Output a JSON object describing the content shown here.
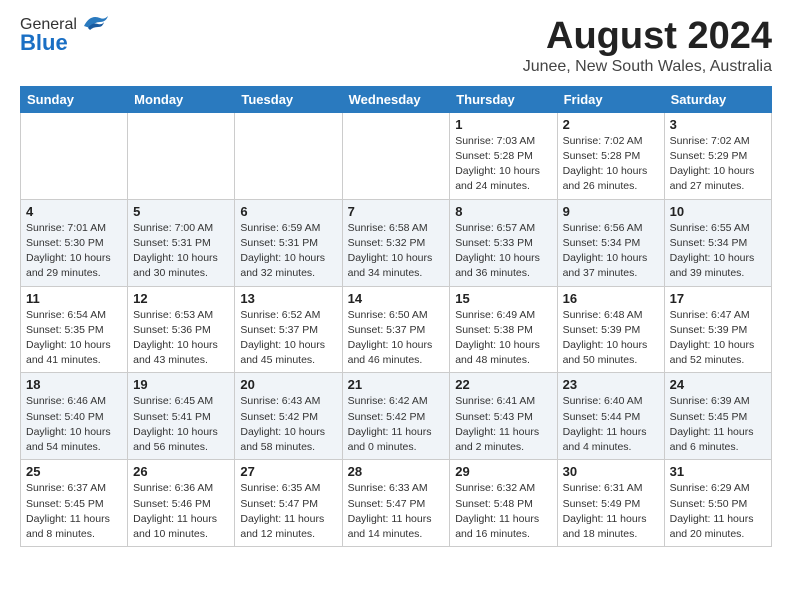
{
  "logo": {
    "general": "General",
    "blue": "Blue"
  },
  "title": "August 2024",
  "subtitle": "Junee, New South Wales, Australia",
  "weekdays": [
    "Sunday",
    "Monday",
    "Tuesday",
    "Wednesday",
    "Thursday",
    "Friday",
    "Saturday"
  ],
  "weeks": [
    [
      {
        "day": "",
        "info": ""
      },
      {
        "day": "",
        "info": ""
      },
      {
        "day": "",
        "info": ""
      },
      {
        "day": "",
        "info": ""
      },
      {
        "day": "1",
        "info": "Sunrise: 7:03 AM\nSunset: 5:28 PM\nDaylight: 10 hours\nand 24 minutes."
      },
      {
        "day": "2",
        "info": "Sunrise: 7:02 AM\nSunset: 5:28 PM\nDaylight: 10 hours\nand 26 minutes."
      },
      {
        "day": "3",
        "info": "Sunrise: 7:02 AM\nSunset: 5:29 PM\nDaylight: 10 hours\nand 27 minutes."
      }
    ],
    [
      {
        "day": "4",
        "info": "Sunrise: 7:01 AM\nSunset: 5:30 PM\nDaylight: 10 hours\nand 29 minutes."
      },
      {
        "day": "5",
        "info": "Sunrise: 7:00 AM\nSunset: 5:31 PM\nDaylight: 10 hours\nand 30 minutes."
      },
      {
        "day": "6",
        "info": "Sunrise: 6:59 AM\nSunset: 5:31 PM\nDaylight: 10 hours\nand 32 minutes."
      },
      {
        "day": "7",
        "info": "Sunrise: 6:58 AM\nSunset: 5:32 PM\nDaylight: 10 hours\nand 34 minutes."
      },
      {
        "day": "8",
        "info": "Sunrise: 6:57 AM\nSunset: 5:33 PM\nDaylight: 10 hours\nand 36 minutes."
      },
      {
        "day": "9",
        "info": "Sunrise: 6:56 AM\nSunset: 5:34 PM\nDaylight: 10 hours\nand 37 minutes."
      },
      {
        "day": "10",
        "info": "Sunrise: 6:55 AM\nSunset: 5:34 PM\nDaylight: 10 hours\nand 39 minutes."
      }
    ],
    [
      {
        "day": "11",
        "info": "Sunrise: 6:54 AM\nSunset: 5:35 PM\nDaylight: 10 hours\nand 41 minutes."
      },
      {
        "day": "12",
        "info": "Sunrise: 6:53 AM\nSunset: 5:36 PM\nDaylight: 10 hours\nand 43 minutes."
      },
      {
        "day": "13",
        "info": "Sunrise: 6:52 AM\nSunset: 5:37 PM\nDaylight: 10 hours\nand 45 minutes."
      },
      {
        "day": "14",
        "info": "Sunrise: 6:50 AM\nSunset: 5:37 PM\nDaylight: 10 hours\nand 46 minutes."
      },
      {
        "day": "15",
        "info": "Sunrise: 6:49 AM\nSunset: 5:38 PM\nDaylight: 10 hours\nand 48 minutes."
      },
      {
        "day": "16",
        "info": "Sunrise: 6:48 AM\nSunset: 5:39 PM\nDaylight: 10 hours\nand 50 minutes."
      },
      {
        "day": "17",
        "info": "Sunrise: 6:47 AM\nSunset: 5:39 PM\nDaylight: 10 hours\nand 52 minutes."
      }
    ],
    [
      {
        "day": "18",
        "info": "Sunrise: 6:46 AM\nSunset: 5:40 PM\nDaylight: 10 hours\nand 54 minutes."
      },
      {
        "day": "19",
        "info": "Sunrise: 6:45 AM\nSunset: 5:41 PM\nDaylight: 10 hours\nand 56 minutes."
      },
      {
        "day": "20",
        "info": "Sunrise: 6:43 AM\nSunset: 5:42 PM\nDaylight: 10 hours\nand 58 minutes."
      },
      {
        "day": "21",
        "info": "Sunrise: 6:42 AM\nSunset: 5:42 PM\nDaylight: 11 hours\nand 0 minutes."
      },
      {
        "day": "22",
        "info": "Sunrise: 6:41 AM\nSunset: 5:43 PM\nDaylight: 11 hours\nand 2 minutes."
      },
      {
        "day": "23",
        "info": "Sunrise: 6:40 AM\nSunset: 5:44 PM\nDaylight: 11 hours\nand 4 minutes."
      },
      {
        "day": "24",
        "info": "Sunrise: 6:39 AM\nSunset: 5:45 PM\nDaylight: 11 hours\nand 6 minutes."
      }
    ],
    [
      {
        "day": "25",
        "info": "Sunrise: 6:37 AM\nSunset: 5:45 PM\nDaylight: 11 hours\nand 8 minutes."
      },
      {
        "day": "26",
        "info": "Sunrise: 6:36 AM\nSunset: 5:46 PM\nDaylight: 11 hours\nand 10 minutes."
      },
      {
        "day": "27",
        "info": "Sunrise: 6:35 AM\nSunset: 5:47 PM\nDaylight: 11 hours\nand 12 minutes."
      },
      {
        "day": "28",
        "info": "Sunrise: 6:33 AM\nSunset: 5:47 PM\nDaylight: 11 hours\nand 14 minutes."
      },
      {
        "day": "29",
        "info": "Sunrise: 6:32 AM\nSunset: 5:48 PM\nDaylight: 11 hours\nand 16 minutes."
      },
      {
        "day": "30",
        "info": "Sunrise: 6:31 AM\nSunset: 5:49 PM\nDaylight: 11 hours\nand 18 minutes."
      },
      {
        "day": "31",
        "info": "Sunrise: 6:29 AM\nSunset: 5:50 PM\nDaylight: 11 hours\nand 20 minutes."
      }
    ]
  ]
}
